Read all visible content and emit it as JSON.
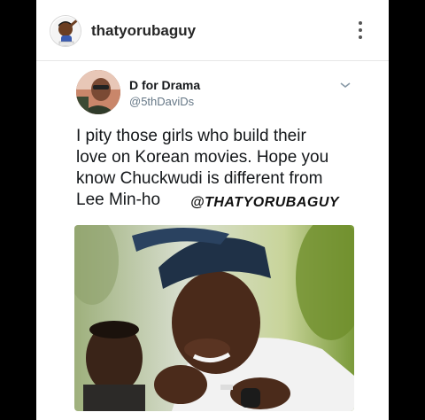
{
  "post": {
    "username": "thatyorubaguy"
  },
  "tweet": {
    "display_name": "D for Drama",
    "handle": "@5thDaviDs",
    "text_lines": [
      "I pity those girls who build their",
      "love on Korean movies. Hope you",
      "know Chuckwudi is different from",
      "Lee Min-ho"
    ]
  },
  "watermark": "@THATYORUBAGUY",
  "icons": {
    "poster_avatar": "cartoon-avatar-icon",
    "more": "more-vertical-icon",
    "tweet_menu": "chevron-down-icon"
  },
  "colors": {
    "page_background": "#000000",
    "card_background": "#ffffff",
    "text_primary": "#14171a",
    "text_secondary": "#657786"
  }
}
